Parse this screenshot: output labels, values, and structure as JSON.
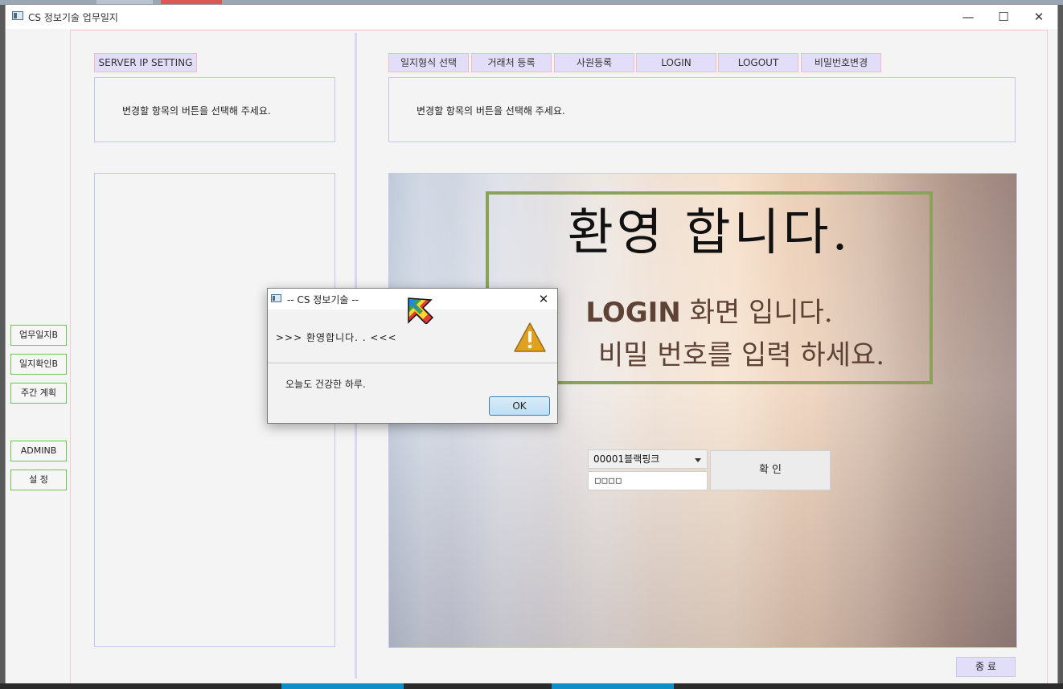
{
  "window": {
    "title": "CS 정보기술 업무일지",
    "controls": {
      "minimize": "—",
      "maximize": "☐",
      "close": "✕"
    }
  },
  "sidebar": {
    "items": [
      {
        "label": "업무일지B"
      },
      {
        "label": "일지확인B"
      },
      {
        "label": "주간 계획"
      },
      {
        "label": "ADMINB"
      },
      {
        "label": "설  정"
      }
    ]
  },
  "left_panel": {
    "button": "SERVER IP SETTING",
    "message": "변경할 항목의 버튼을 선택해 주세요."
  },
  "top_toolbar": {
    "buttons": [
      {
        "label": "일지형식 선택"
      },
      {
        "label": "거래처 등록"
      },
      {
        "label": "사원등록"
      },
      {
        "label": "LOGIN"
      },
      {
        "label": "LOGOUT"
      },
      {
        "label": "비밀번호변경"
      }
    ],
    "message": "변경할 항목의 버튼을 선택해 주세요."
  },
  "welcome": {
    "title": "환영 합니다.",
    "login_word": "LOGIN",
    "line1_rest": " 화면 입니다.",
    "line2": "비밀 번호를 입력 하세요."
  },
  "login": {
    "user_select": "00001블랙핑크",
    "password_value": "□□□□",
    "confirm_label": "확 인"
  },
  "exit_button": "종   료",
  "dialog": {
    "title": "-- CS 정보기술  --",
    "header": ">>>  환영합니다. . <<<",
    "message": "오늘도 건강한 하루.",
    "ok_label": "OK",
    "close": "✕",
    "icons": [
      "warning-icon",
      "kite-logo-icon"
    ],
    "colors": {
      "warning": "#e0a020",
      "ok_border": "#3c7fb1"
    }
  }
}
